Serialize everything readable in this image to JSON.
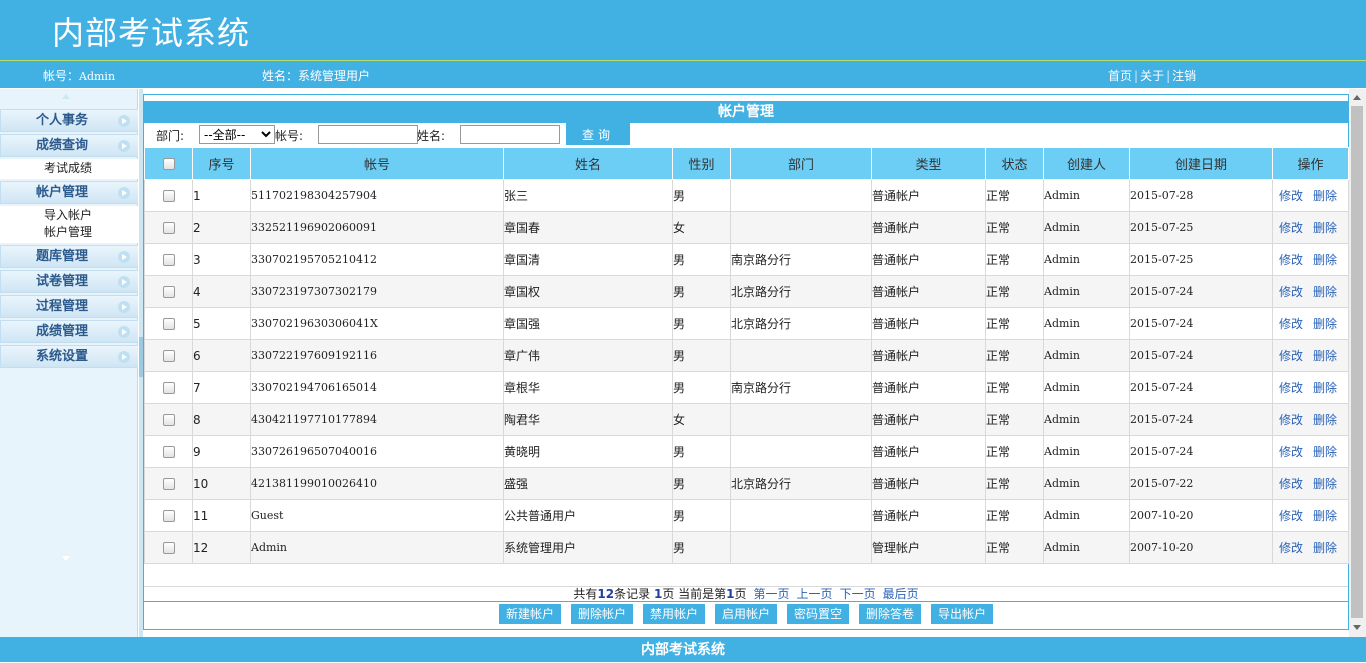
{
  "header": {
    "title": "内部考试系统"
  },
  "infobar": {
    "account_label": "帐号：",
    "account_value": "Admin",
    "name_label": "姓名：",
    "name_value": "系统管理用户",
    "links": [
      "首页",
      "关于",
      "注销"
    ],
    "separator": "|"
  },
  "sidebar": {
    "sections": [
      {
        "label": "个人事务",
        "items": []
      },
      {
        "label": "成绩查询",
        "items": [
          "考试成绩"
        ]
      },
      {
        "label": "帐户管理",
        "items": [
          "导入帐户",
          "帐户管理"
        ]
      },
      {
        "label": "题库管理",
        "items": []
      },
      {
        "label": "试卷管理",
        "items": []
      },
      {
        "label": "过程管理",
        "items": []
      },
      {
        "label": "成绩管理",
        "items": []
      },
      {
        "label": "系统设置",
        "items": []
      }
    ]
  },
  "main": {
    "panel_title": "帐户管理",
    "search": {
      "dept_label": "部门:",
      "dept_selected": "--全部--",
      "account_label": "帐号:",
      "account_value": "",
      "name_label": "姓名:",
      "name_value": "",
      "query_button": "查询"
    },
    "columns": [
      "序号",
      "帐号",
      "姓名",
      "性别",
      "部门",
      "类型",
      "状态",
      "创建人",
      "创建日期",
      "操作"
    ],
    "rows": [
      {
        "seq": "1",
        "account": "511702198304257904",
        "name": "张三",
        "gender": "男",
        "dept": "",
        "type": "普通帐户",
        "status": "正常",
        "creator": "Admin",
        "date": "2015-07-28"
      },
      {
        "seq": "2",
        "account": "332521196902060091",
        "name": "章国春",
        "gender": "女",
        "dept": "",
        "type": "普通帐户",
        "status": "正常",
        "creator": "Admin",
        "date": "2015-07-25"
      },
      {
        "seq": "3",
        "account": "330702195705210412",
        "name": "章国清",
        "gender": "男",
        "dept": "南京路分行",
        "type": "普通帐户",
        "status": "正常",
        "creator": "Admin",
        "date": "2015-07-25"
      },
      {
        "seq": "4",
        "account": "330723197307302179",
        "name": "章国权",
        "gender": "男",
        "dept": "北京路分行",
        "type": "普通帐户",
        "status": "正常",
        "creator": "Admin",
        "date": "2015-07-24"
      },
      {
        "seq": "5",
        "account": "33070219630306041X",
        "name": "章国强",
        "gender": "男",
        "dept": "北京路分行",
        "type": "普通帐户",
        "status": "正常",
        "creator": "Admin",
        "date": "2015-07-24"
      },
      {
        "seq": "6",
        "account": "330722197609192116",
        "name": "章广伟",
        "gender": "男",
        "dept": "",
        "type": "普通帐户",
        "status": "正常",
        "creator": "Admin",
        "date": "2015-07-24"
      },
      {
        "seq": "7",
        "account": "330702194706165014",
        "name": "章根华",
        "gender": "男",
        "dept": "南京路分行",
        "type": "普通帐户",
        "status": "正常",
        "creator": "Admin",
        "date": "2015-07-24"
      },
      {
        "seq": "8",
        "account": "430421197710177894",
        "name": "陶君华",
        "gender": "女",
        "dept": "",
        "type": "普通帐户",
        "status": "正常",
        "creator": "Admin",
        "date": "2015-07-24"
      },
      {
        "seq": "9",
        "account": "330726196507040016",
        "name": "黄晓明",
        "gender": "男",
        "dept": "",
        "type": "普通帐户",
        "status": "正常",
        "creator": "Admin",
        "date": "2015-07-24"
      },
      {
        "seq": "10",
        "account": "421381199010026410",
        "name": "盛强",
        "gender": "男",
        "dept": "北京路分行",
        "type": "普通帐户",
        "status": "正常",
        "creator": "Admin",
        "date": "2015-07-22"
      },
      {
        "seq": "11",
        "account": "Guest",
        "name": "公共普通用户",
        "gender": "男",
        "dept": "",
        "type": "普通帐户",
        "status": "正常",
        "creator": "Admin",
        "date": "2007-10-20"
      },
      {
        "seq": "12",
        "account": "Admin",
        "name": "系统管理用户",
        "gender": "男",
        "dept": "",
        "type": "管理帐户",
        "status": "正常",
        "creator": "Admin",
        "date": "2007-10-20"
      }
    ],
    "row_actions": {
      "edit": "修改",
      "delete": "删除"
    },
    "pager": {
      "t1": "共有",
      "total": "12",
      "t2": "条记录",
      "pages": "1",
      "t3": "页 当前是第",
      "current": "1",
      "t4": "页",
      "first": "第一页",
      "prev": "上一页",
      "next": "下一页",
      "last": "最后页"
    },
    "actions": [
      "新建帐户",
      "删除帐户",
      "禁用帐户",
      "启用帐户",
      "密码置空",
      "删除答卷",
      "导出帐户"
    ]
  },
  "footer": {
    "text": "内部考试系统"
  },
  "colors": {
    "brand": "#41b0e3",
    "table_header": "#6ccdf5",
    "link": "#2a62b8"
  }
}
